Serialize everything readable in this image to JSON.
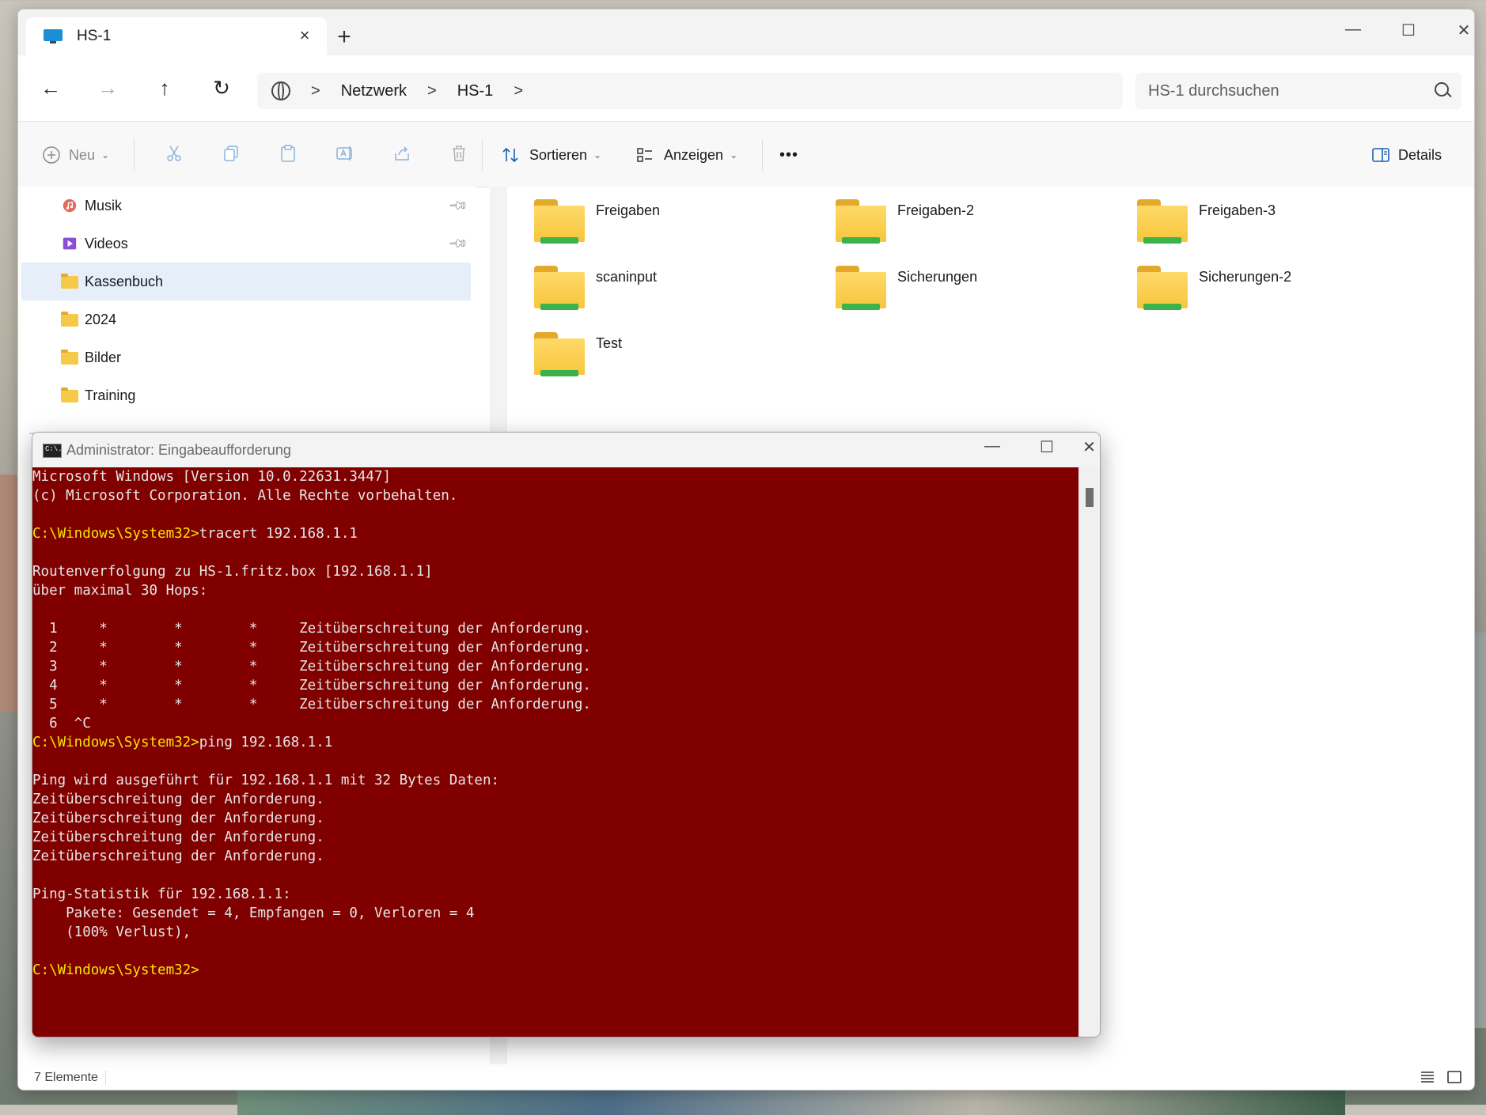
{
  "explorer": {
    "tab_title": "HS-1",
    "tab_close": "×",
    "new_tab": "+",
    "window_controls": {
      "minimize": "—",
      "maximize": "☐",
      "close": "✕"
    },
    "nav": {
      "back": "←",
      "forward": "→",
      "up": "↑",
      "refresh": "↻"
    },
    "breadcrumb": {
      "items": [
        "Netzwerk",
        "HS-1"
      ],
      "separator": ">"
    },
    "search": {
      "placeholder": "HS-1 durchsuchen"
    },
    "commandbar": {
      "new_label": "Neu",
      "sort_label": "Sortieren",
      "view_label": "Anzeigen",
      "more_label": "•••",
      "details_label": "Details"
    },
    "sidebar": {
      "items": [
        {
          "label": "Musik",
          "icon": "music-icon",
          "pinned": true
        },
        {
          "label": "Videos",
          "icon": "video-icon",
          "pinned": true
        },
        {
          "label": "Kassenbuch",
          "icon": "folder-icon",
          "selected": true
        },
        {
          "label": "2024",
          "icon": "folder-icon"
        },
        {
          "label": "Bilder",
          "icon": "folder-icon"
        },
        {
          "label": "Training",
          "icon": "folder-icon"
        }
      ]
    },
    "folders": [
      "Freigaben",
      "Freigaben-2",
      "Freigaben-3",
      "scaninput",
      "Sicherungen",
      "Sicherungen-2",
      "Test"
    ],
    "status": {
      "count": "7 Elemente"
    }
  },
  "cmd": {
    "title": "Administrator: Eingabeaufforderung",
    "icon_text": "C:\\.",
    "lines": [
      {
        "text": "Microsoft Windows [Version 10.0.22631.3447]"
      },
      {
        "text": "(c) Microsoft Corporation. Alle Rechte vorbehalten."
      },
      {
        "text": ""
      },
      {
        "prompt": "C:\\Windows\\System32>",
        "text": "tracert 192.168.1.1"
      },
      {
        "text": ""
      },
      {
        "text": "Routenverfolgung zu HS-1.fritz.box [192.168.1.1]"
      },
      {
        "text": "über maximal 30 Hops:"
      },
      {
        "text": ""
      },
      {
        "text": "  1     *        *        *     Zeitüberschreitung der Anforderung."
      },
      {
        "text": "  2     *        *        *     Zeitüberschreitung der Anforderung."
      },
      {
        "text": "  3     *        *        *     Zeitüberschreitung der Anforderung."
      },
      {
        "text": "  4     *        *        *     Zeitüberschreitung der Anforderung."
      },
      {
        "text": "  5     *        *        *     Zeitüberschreitung der Anforderung."
      },
      {
        "text": "  6  ^C"
      },
      {
        "prompt": "C:\\Windows\\System32>",
        "text": "ping 192.168.1.1"
      },
      {
        "text": ""
      },
      {
        "text": "Ping wird ausgeführt für 192.168.1.1 mit 32 Bytes Daten:"
      },
      {
        "text": "Zeitüberschreitung der Anforderung."
      },
      {
        "text": "Zeitüberschreitung der Anforderung."
      },
      {
        "text": "Zeitüberschreitung der Anforderung."
      },
      {
        "text": "Zeitüberschreitung der Anforderung."
      },
      {
        "text": ""
      },
      {
        "text": "Ping-Statistik für 192.168.1.1:"
      },
      {
        "text": "    Pakete: Gesendet = 4, Empfangen = 0, Verloren = 4"
      },
      {
        "text": "    (100% Verlust),"
      },
      {
        "text": ""
      },
      {
        "prompt": "C:\\Windows\\System32>",
        "text": ""
      }
    ],
    "colors": {
      "background": "#800000",
      "text": "#e6e6e6",
      "prompt": "#f5e600"
    }
  }
}
